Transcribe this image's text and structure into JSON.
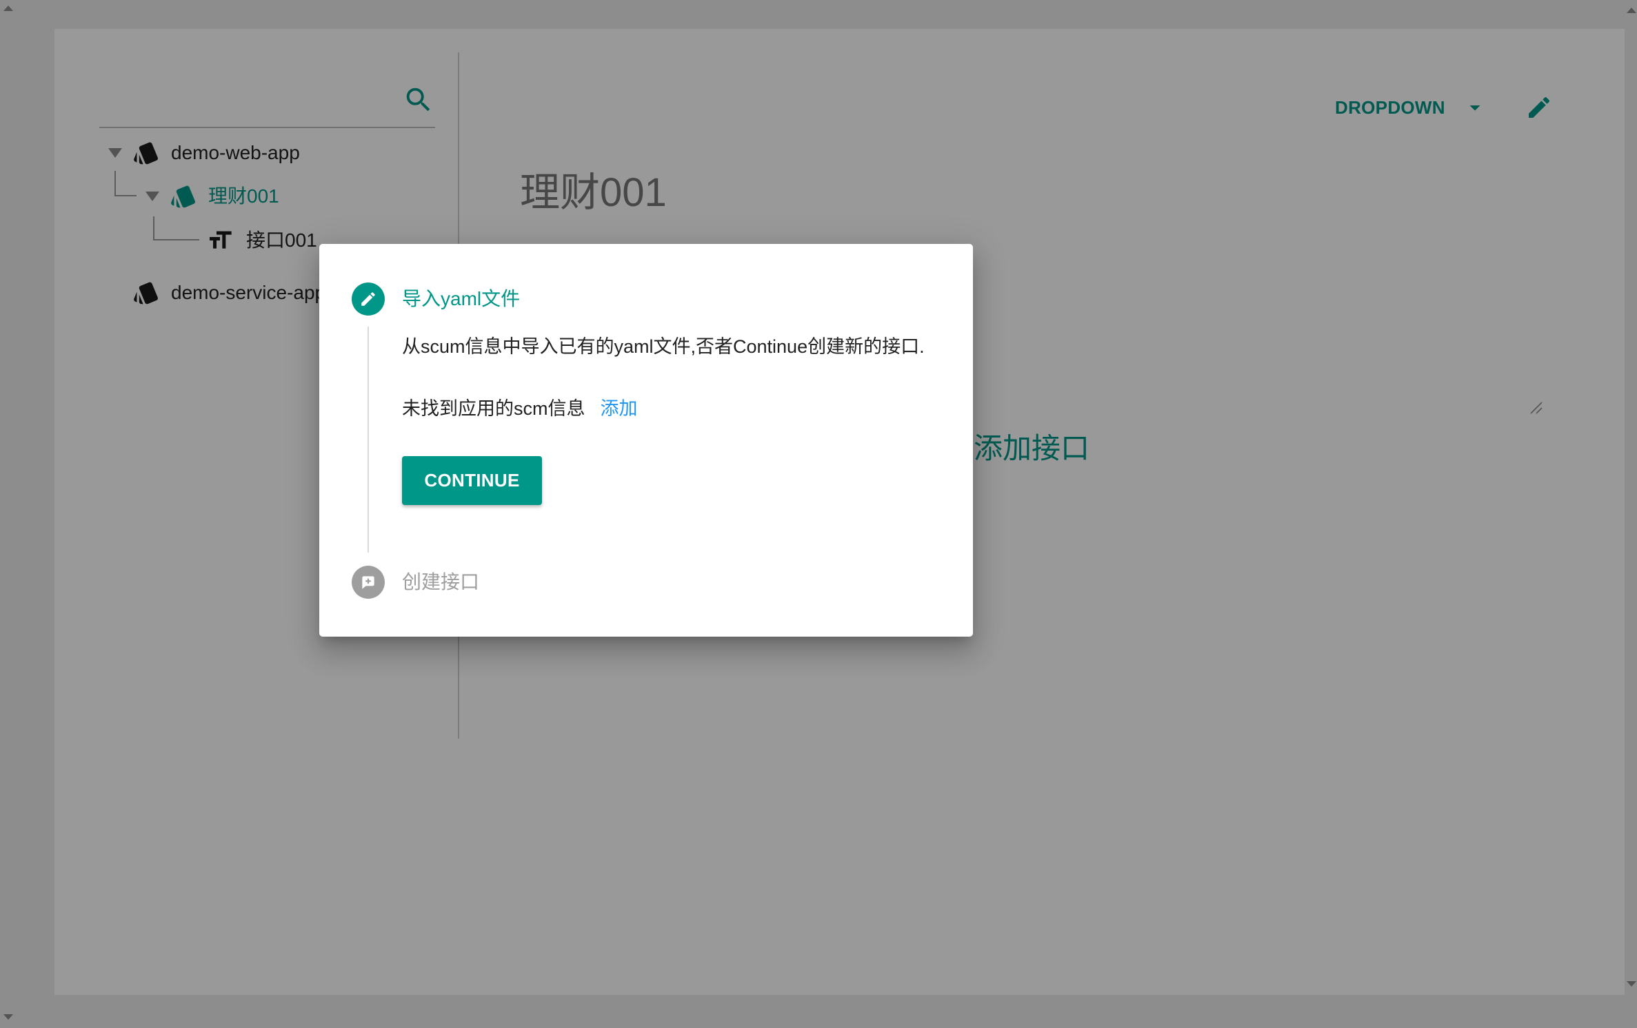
{
  "window": {
    "scroll_up_icon": "scroll-up-arrow-icon",
    "scroll_down_icon": "scroll-down-arrow-icon"
  },
  "sidebar": {
    "search": {
      "value": "",
      "placeholder": "",
      "icon": "search-icon"
    },
    "tree": [
      {
        "label": "demo-web-app",
        "icon": "style-icon",
        "expanded": true,
        "selected": false
      },
      {
        "label": "理财001",
        "icon": "style-icon",
        "expanded": true,
        "selected": true
      },
      {
        "label": "接口001",
        "icon": "format-size-icon",
        "selected": false
      },
      {
        "label": "demo-service-app",
        "icon": "style-icon",
        "expanded": false,
        "selected": false
      }
    ]
  },
  "header": {
    "dropdown_label": "DROPDOWN",
    "dropdown_icon": "arrow-drop-down-icon",
    "edit_icon": "pencil-icon"
  },
  "main": {
    "title": "理财001",
    "text_area": {
      "value": "",
      "placeholder": ""
    },
    "add_interface_label": "添加接口"
  },
  "dialog": {
    "steps": [
      {
        "label": "导入yaml文件",
        "icon": "pencil-icon",
        "active": true
      },
      {
        "label": "创建接口",
        "icon": "add-comment-icon",
        "active": false
      }
    ],
    "description": "从scum信息中导入已有的yaml文件,否者Continue创建新的接口.",
    "scm_notice": "未找到应用的scm信息",
    "scm_add_link": "添加",
    "continue_label": "CONTINUE"
  },
  "colors": {
    "primary": "#009688",
    "link": "#2196f3",
    "inactive": "#9e9e9e"
  }
}
